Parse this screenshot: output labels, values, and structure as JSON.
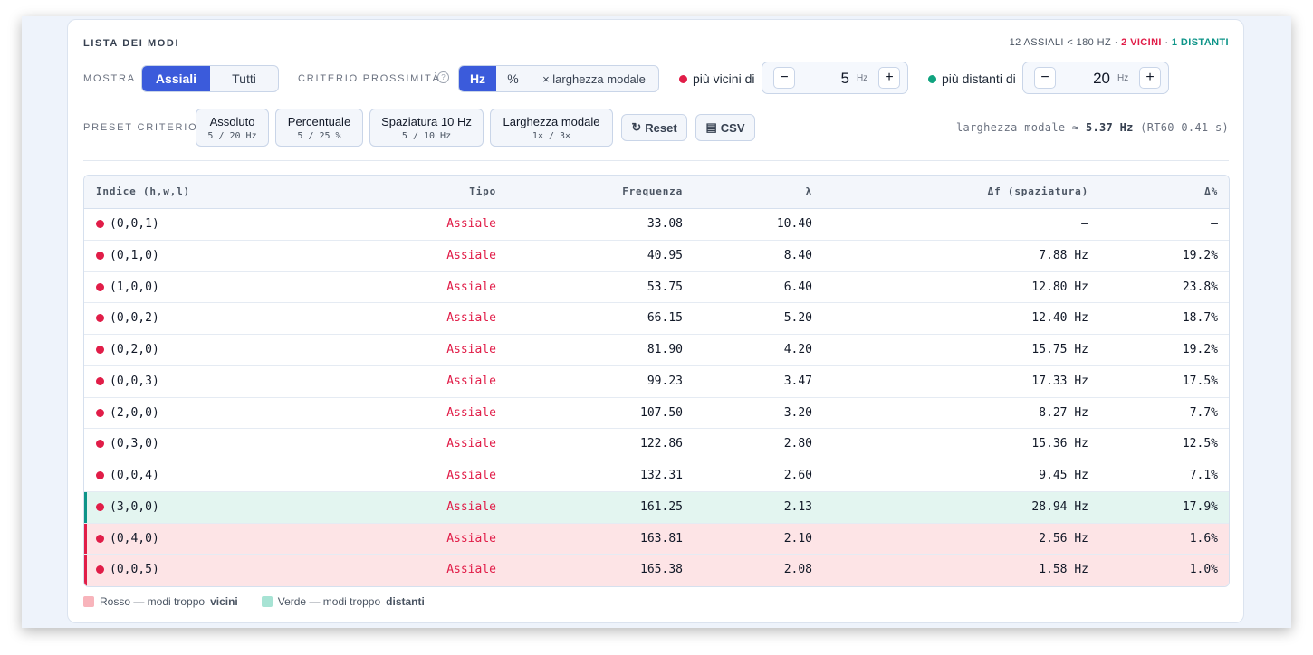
{
  "title": "LISTA DEI MODI",
  "summary": {
    "axial": "12 ASSIALI < 180 HZ",
    "sep": "·",
    "near": "2 VICINI",
    "far": "1 DISTANTI"
  },
  "show": {
    "label": "MOSTRA",
    "options": [
      "Assiali",
      "Tutti"
    ],
    "selected": "Assiali"
  },
  "criterion": {
    "label": "CRITERIO PROSSIMITÀ",
    "help_icon": "?",
    "options": [
      "Hz",
      "%",
      "× larghezza modale"
    ],
    "selected": "Hz"
  },
  "near": {
    "label": "più vicini di",
    "value": "5",
    "unit": "Hz",
    "minus": "−",
    "plus": "+",
    "color": "#e11d48"
  },
  "far": {
    "label": "più distanti di",
    "value": "20",
    "unit": "Hz",
    "minus": "−",
    "plus": "+",
    "color": "#10a37f"
  },
  "preset": {
    "label": "PRESET CRITERIO",
    "items": [
      {
        "name": "Assoluto",
        "sub": "5 / 20 Hz"
      },
      {
        "name": "Percentuale",
        "sub": "5 / 25 %"
      },
      {
        "name": "Spaziatura 10 Hz",
        "sub": "5 / 10 Hz"
      },
      {
        "name": "Larghezza modale",
        "sub": "1× / 3×"
      }
    ],
    "reset": {
      "icon": "↻",
      "label": "Reset"
    },
    "csv": {
      "icon": "▤",
      "label": "CSV"
    }
  },
  "modal_info": {
    "prefix": "larghezza modale ≈",
    "value": "5.37 Hz",
    "suffix": "(RT60 0.41 s)"
  },
  "table": {
    "headers": [
      "Indice (h,w,l)",
      "Tipo",
      "Frequenza",
      "λ",
      "Δf (spaziatura)",
      "Δ%"
    ],
    "rows": [
      {
        "idx": "(0,0,1)",
        "type": "Assiale",
        "freq": "33.08",
        "lam": "10.40",
        "df": "—",
        "dp": "—",
        "state": ""
      },
      {
        "idx": "(0,1,0)",
        "type": "Assiale",
        "freq": "40.95",
        "lam": "8.40",
        "df": "7.88 Hz",
        "dp": "19.2%",
        "state": ""
      },
      {
        "idx": "(1,0,0)",
        "type": "Assiale",
        "freq": "53.75",
        "lam": "6.40",
        "df": "12.80 Hz",
        "dp": "23.8%",
        "state": ""
      },
      {
        "idx": "(0,0,2)",
        "type": "Assiale",
        "freq": "66.15",
        "lam": "5.20",
        "df": "12.40 Hz",
        "dp": "18.7%",
        "state": ""
      },
      {
        "idx": "(0,2,0)",
        "type": "Assiale",
        "freq": "81.90",
        "lam": "4.20",
        "df": "15.75 Hz",
        "dp": "19.2%",
        "state": ""
      },
      {
        "idx": "(0,0,3)",
        "type": "Assiale",
        "freq": "99.23",
        "lam": "3.47",
        "df": "17.33 Hz",
        "dp": "17.5%",
        "state": ""
      },
      {
        "idx": "(2,0,0)",
        "type": "Assiale",
        "freq": "107.50",
        "lam": "3.20",
        "df": "8.27 Hz",
        "dp": "7.7%",
        "state": ""
      },
      {
        "idx": "(0,3,0)",
        "type": "Assiale",
        "freq": "122.86",
        "lam": "2.80",
        "df": "15.36 Hz",
        "dp": "12.5%",
        "state": ""
      },
      {
        "idx": "(0,0,4)",
        "type": "Assiale",
        "freq": "132.31",
        "lam": "2.60",
        "df": "9.45 Hz",
        "dp": "7.1%",
        "state": ""
      },
      {
        "idx": "(3,0,0)",
        "type": "Assiale",
        "freq": "161.25",
        "lam": "2.13",
        "df": "28.94 Hz",
        "dp": "17.9%",
        "state": "far"
      },
      {
        "idx": "(0,4,0)",
        "type": "Assiale",
        "freq": "163.81",
        "lam": "2.10",
        "df": "2.56 Hz",
        "dp": "1.6%",
        "state": "close"
      },
      {
        "idx": "(0,0,5)",
        "type": "Assiale",
        "freq": "165.38",
        "lam": "2.08",
        "df": "1.58 Hz",
        "dp": "1.0%",
        "state": "close"
      }
    ]
  },
  "legend": {
    "red": {
      "text": "Rosso — modi troppo",
      "bold": "vicini",
      "color": "#f8b4bb"
    },
    "green": {
      "text": "Verde — modi troppo",
      "bold": "distanti",
      "color": "#a7e3d4"
    }
  }
}
